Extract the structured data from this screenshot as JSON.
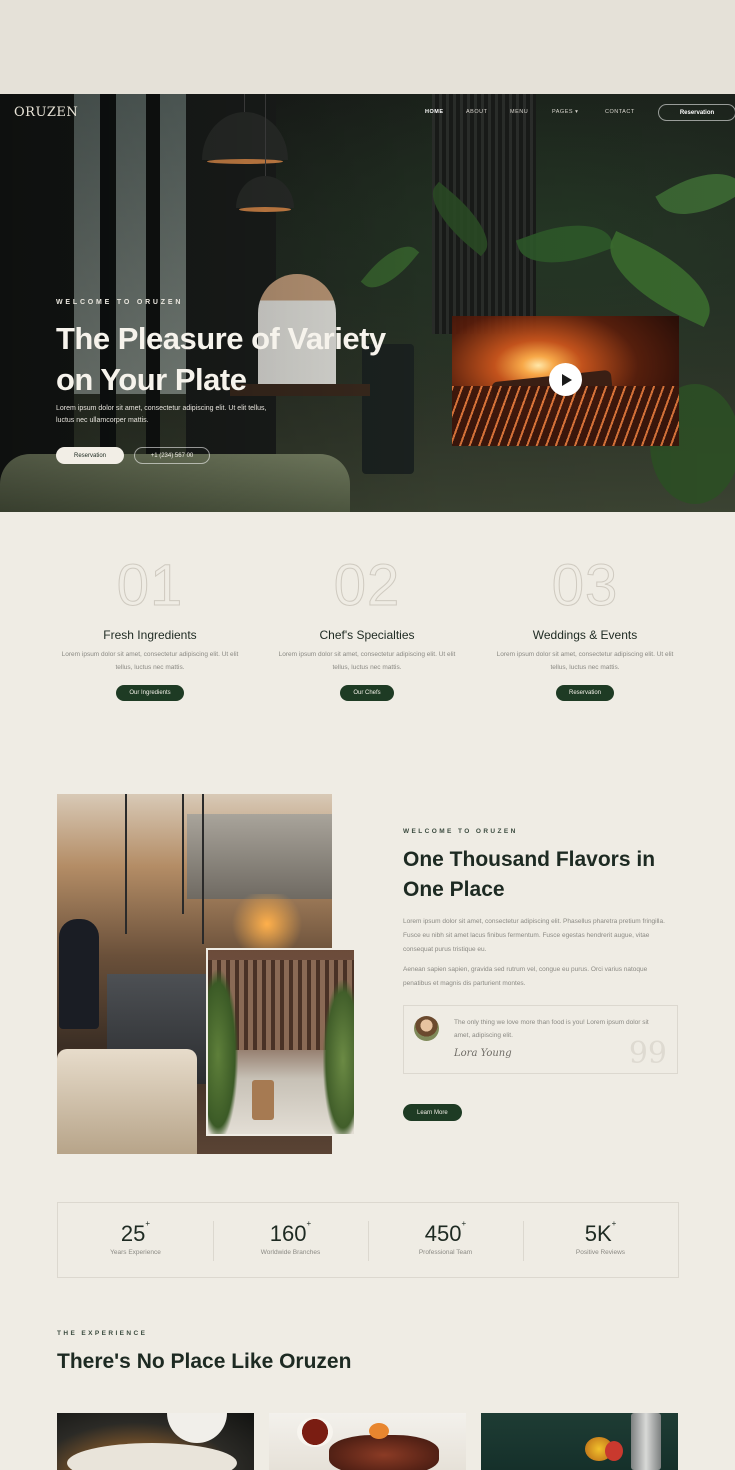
{
  "nav": {
    "logo": "ORUZEN",
    "items": [
      {
        "label": "HOME",
        "active": true
      },
      {
        "label": "ABOUT",
        "active": false
      },
      {
        "label": "MENU",
        "active": false
      },
      {
        "label": "PAGES ▾",
        "active": false
      },
      {
        "label": "CONTACT",
        "active": false
      }
    ],
    "cta": "Reservation"
  },
  "hero": {
    "eyebrow": "WELCOME TO ORUZEN",
    "title": "The Pleasure of Variety on Your Plate",
    "text": "Lorem ipsum dolor sit amet, consectetur adipiscing elit. Ut elit tellus, luctus nec ullamcorper mattis.",
    "primary_button": "Reservation",
    "phone": "+1 (234) 567 00",
    "video_icon": "play-icon"
  },
  "features": [
    {
      "number": "01",
      "title": "Fresh Ingredients",
      "text": "Lorem ipsum dolor sit amet, consectetur adipiscing elit. Ut elit tellus, luctus nec mattis.",
      "button": "Our Ingredients"
    },
    {
      "number": "02",
      "title": "Chef's Specialties",
      "text": "Lorem ipsum dolor sit amet, consectetur adipiscing elit. Ut elit tellus, luctus nec mattis.",
      "button": "Our Chefs"
    },
    {
      "number": "03",
      "title": "Weddings & Events",
      "text": "Lorem ipsum dolor sit amet, consectetur adipiscing elit. Ut elit tellus, luctus nec mattis.",
      "button": "Reservation"
    }
  ],
  "about": {
    "eyebrow": "WELCOME TO ORUZEN",
    "title": "One Thousand Flavors in One Place",
    "paragraph1": "Lorem ipsum dolor sit amet, consectetur adipiscing elit. Phasellus pharetra pretium fringilla. Fusce eu nibh sit amet lacus finibus fermentum. Fusce egestas hendrerit augue, vitae consequat purus tristique eu.",
    "paragraph2": "Aenean sapien sapien, gravida sed rutrum vel, congue eu purus. Orci varius natoque penatibus et magnis dis parturient montes.",
    "quote": "The only thing we love more than food is you! Lorem ipsum dolor sit amet, adipiscing elit.",
    "signature": "Lora Young",
    "quote_mark": "99",
    "button": "Learn More"
  },
  "stats": [
    {
      "value": "25",
      "suffix": "+",
      "label": "Years Experience"
    },
    {
      "value": "160",
      "suffix": "+",
      "label": "Worldwide Branches"
    },
    {
      "value": "450",
      "suffix": "+",
      "label": "Professional Team"
    },
    {
      "value": "5K",
      "suffix": "+",
      "label": "Positive Reviews"
    }
  ],
  "experience": {
    "eyebrow": "THE EXPERIENCE",
    "title": "There's No Place Like Oruzen"
  },
  "colors": {
    "accent": "#1e3b24",
    "cream": "#efece4",
    "text": "#1d2a22",
    "muted": "#8b8a84"
  }
}
